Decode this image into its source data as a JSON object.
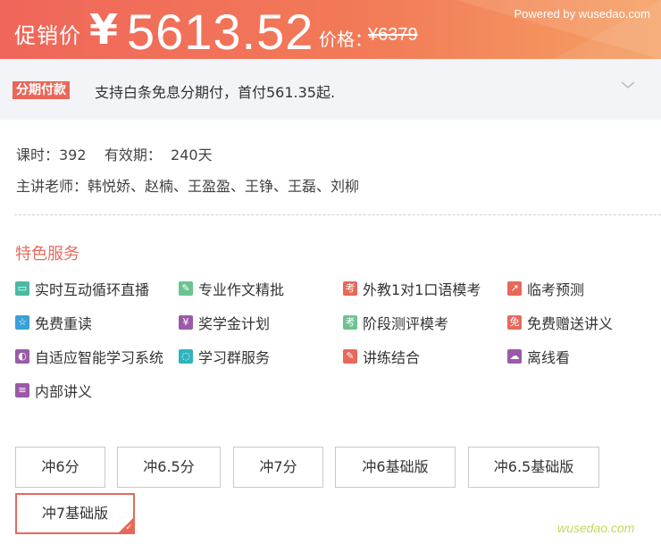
{
  "price": {
    "promo_label": "促销价",
    "currency_symbol": "¥",
    "value": "5613.52",
    "original_label": "价格：",
    "original_value": "¥6379",
    "colors": {
      "banner_start": "#f0665a",
      "banner_end": "#f5a063"
    }
  },
  "watermark_top": "Powered by wusedao.com",
  "installment": {
    "badge": "分期付款",
    "text": "支持白条免息分期付，首付561.35起."
  },
  "course": {
    "hours_line": "课时：392    有效期：  240天",
    "teachers_line": "主讲老师：韩悦娇、赵楠、王盈盈、王铮、王磊、刘柳"
  },
  "services": {
    "title": "特色服务",
    "items": [
      {
        "label": "实时互动循环直播",
        "icon": "monitor-icon",
        "color": "#4cb8a4",
        "glyph": "▭"
      },
      {
        "label": "专业作文精批",
        "icon": "pen-icon",
        "color": "#6cc38f",
        "glyph": "✎"
      },
      {
        "label": "外教1对1口语模考",
        "icon": "exam-icon",
        "color": "#e8685a",
        "glyph": "考"
      },
      {
        "label": "临考预测",
        "icon": "chart-icon",
        "color": "#e8685a",
        "glyph": "↗"
      },
      {
        "label": "免费重读",
        "icon": "star-icon",
        "color": "#3aa0d8",
        "glyph": "☆"
      },
      {
        "label": "奖学金计划",
        "icon": "yen-coin-icon",
        "color": "#9a5aa8",
        "glyph": "¥"
      },
      {
        "label": "阶段测评模考",
        "icon": "exam-icon",
        "color": "#6cc38f",
        "glyph": "考"
      },
      {
        "label": "免费赠送讲义",
        "icon": "gift-icon",
        "color": "#e8685a",
        "glyph": "免"
      },
      {
        "label": "自适应智能学习系统",
        "icon": "brain-icon",
        "color": "#9a5aa8",
        "glyph": "◐"
      },
      {
        "label": "学习群服务",
        "icon": "chat-icon",
        "color": "#2fb3c0",
        "glyph": "◌"
      },
      {
        "label": "讲练结合",
        "icon": "edit-icon",
        "color": "#e8685a",
        "glyph": "✎"
      },
      {
        "label": "离线看",
        "icon": "cloud-icon",
        "color": "#9a5aa8",
        "glyph": "☁"
      },
      {
        "label": "内部讲义",
        "icon": "document-icon",
        "color": "#9a5aa8",
        "glyph": "≡"
      }
    ]
  },
  "tiers": {
    "options": [
      "冲6分",
      "冲6.5分",
      "冲7分",
      "冲6基础版",
      "冲6.5基础版",
      "冲7基础版"
    ],
    "selected": "冲7基础版",
    "accent": "#e8685a"
  },
  "watermark_bottom": "wusedao.com"
}
